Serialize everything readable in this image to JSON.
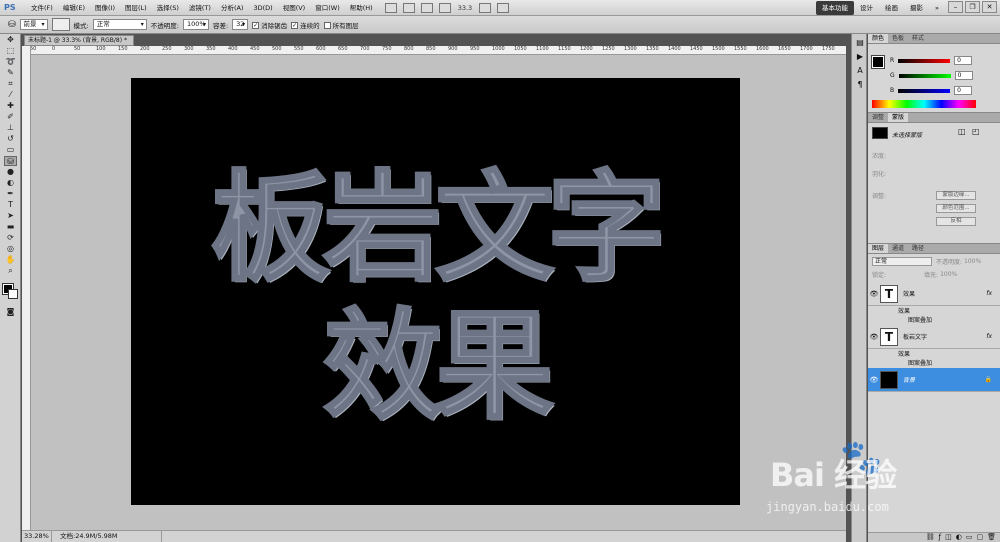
{
  "app": {
    "logo": "PS"
  },
  "menu": [
    "文件(F)",
    "编辑(E)",
    "图像(I)",
    "图层(L)",
    "选择(S)",
    "滤镜(T)",
    "分析(A)",
    "3D(D)",
    "视图(V)",
    "窗口(W)",
    "帮助(H)"
  ],
  "menubar": {
    "zoom": "33.3"
  },
  "workspaces": [
    "基本功能",
    "设计",
    "绘画",
    "摄影",
    "»"
  ],
  "options": {
    "preset": "前景",
    "mode_label": "模式:",
    "mode_value": "正常",
    "opacity_label": "不透明度:",
    "opacity_value": "100%",
    "tolerance_label": "容差:",
    "tolerance_value": "32",
    "antialias": "消除锯齿",
    "contiguous": "连续的",
    "all_layers": "所有图层"
  },
  "document": {
    "tab_title": "未标题-1 @ 33.3% (背景, RGB/8) *",
    "ruler_ticks": [
      "50",
      "0",
      "50",
      "100",
      "150",
      "200",
      "250",
      "300",
      "350",
      "400",
      "450",
      "500",
      "550",
      "600",
      "650",
      "700",
      "750",
      "800",
      "850",
      "900",
      "950",
      "1000",
      "1050",
      "1100",
      "1150",
      "1200",
      "1250",
      "1300",
      "1350",
      "1400",
      "1450",
      "1500",
      "1550",
      "1600",
      "1650",
      "1700",
      "1750"
    ],
    "canvas_line1": "板岩文字",
    "canvas_line2": "效果"
  },
  "statusbar": {
    "zoom": "33.28%",
    "doc_info": "文档:24.9M/5.98M"
  },
  "color_panel": {
    "tabs": [
      "颜色",
      "色板",
      "样式"
    ],
    "r_label": "R",
    "g_label": "G",
    "b_label": "B",
    "r": "0",
    "g": "0",
    "b": "0"
  },
  "masks_panel": {
    "tabs": [
      "调整",
      "蒙版"
    ],
    "title": "未选择蒙版",
    "density": "浓度:",
    "feather": "羽化:",
    "refine": "调整:",
    "edge_button": "蒙版边缘...",
    "color_range_button": "颜色范围...",
    "invert_button": "反相"
  },
  "layers_panel": {
    "tabs": [
      "图层",
      "通道",
      "路径"
    ],
    "blend_mode": "正常",
    "opacity_label": "不透明度:",
    "opacity": "100%",
    "lock_label": "锁定:",
    "fill_label": "填充:",
    "fill": "100%",
    "layers": [
      {
        "name": "效果",
        "thumb": "T",
        "fx": "fx",
        "effects": "效果",
        "effect_item": "图案叠加"
      },
      {
        "name": "板岩文字",
        "thumb": "T",
        "fx": "fx",
        "effects": "效果",
        "effect_item": "图案叠加"
      },
      {
        "name": "背景",
        "thumb": "",
        "fx": "",
        "effects": "",
        "effect_item": ""
      }
    ]
  },
  "watermark": {
    "text": "Bai 经验",
    "url": "jingyan.baidu.com"
  }
}
